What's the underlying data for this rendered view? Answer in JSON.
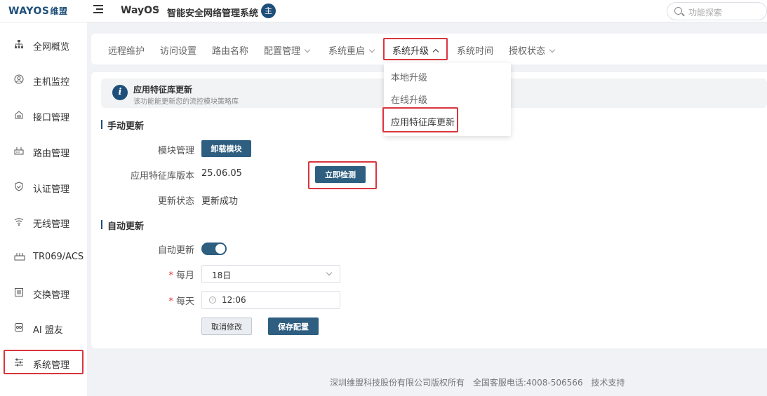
{
  "header": {
    "logo_main": "WAYOS",
    "logo_sub": "维盟",
    "brand": "WayOS",
    "page_title": "智能安全网络管理系统",
    "badge": "主",
    "search_placeholder": "功能探索"
  },
  "sidebar": {
    "items": [
      {
        "label": "全网概览",
        "icon": "network-icon"
      },
      {
        "label": "主机监控",
        "icon": "user-icon"
      },
      {
        "label": "接口管理",
        "icon": "interface-icon"
      },
      {
        "label": "路由管理",
        "icon": "router-icon"
      },
      {
        "label": "认证管理",
        "icon": "shield-icon"
      },
      {
        "label": "无线管理",
        "icon": "wifi-icon"
      },
      {
        "label": "TR069/ACS",
        "icon": "device-icon"
      },
      {
        "label": "交换管理",
        "icon": "switch-icon"
      },
      {
        "label": "AI 盟友",
        "icon": "ai-icon"
      },
      {
        "label": "系统管理",
        "icon": "sliders-icon"
      }
    ],
    "active_index": 9
  },
  "tabs": [
    {
      "label": "远程维护",
      "has_chevron": false
    },
    {
      "label": "访问设置",
      "has_chevron": false
    },
    {
      "label": "路由名称",
      "has_chevron": false
    },
    {
      "label": "配置管理",
      "has_chevron": true
    },
    {
      "label": "系统重启",
      "has_chevron": true
    },
    {
      "label": "系统升级",
      "has_chevron": true
    },
    {
      "label": "系统时间",
      "has_chevron": false
    },
    {
      "label": "授权状态",
      "has_chevron": true
    }
  ],
  "active_tab_index": 5,
  "dropdown": {
    "items": [
      "本地升级",
      "在线升级",
      "应用特征库更新"
    ],
    "selected_index": 2
  },
  "info": {
    "title": "应用特征库更新",
    "description": "该功能能更新您的流控模块策略库"
  },
  "manual": {
    "section_title": "手动更新",
    "module_label": "模块管理",
    "module_button": "卸载模块",
    "version_label": "应用特征库版本",
    "version_value": "25.06.05",
    "check_button": "立即检测",
    "status_label": "更新状态",
    "status_value": "更新成功"
  },
  "auto": {
    "section_title": "自动更新",
    "toggle_label": "自动更新",
    "toggle_on": true,
    "monthly_label": "每月",
    "monthly_value": "18日",
    "daily_label": "每天",
    "daily_value": "12:06",
    "cancel_button": "取消修改",
    "save_button": "保存配置"
  },
  "footer": {
    "copyright": "深圳维盟科技股份有限公司版权所有",
    "hotline": "全国客服电话:4008-506566",
    "support": "技术支持"
  },
  "colors": {
    "primary": "#2e5e80",
    "highlight": "#d9363e",
    "background": "#f0f2f5"
  }
}
